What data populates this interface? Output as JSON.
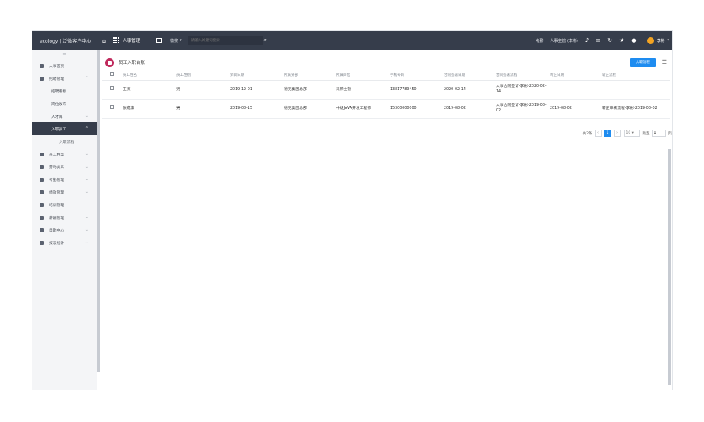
{
  "topbar": {
    "brand": "ecology | 泛微客户中心",
    "module": "人事管理",
    "search_scope": "微搜",
    "search_placeholder": "请输入关键词搜索",
    "right_items": [
      "考勤",
      "人事主管 (李彬)"
    ],
    "user": "李彬"
  },
  "sidebar": {
    "collapse": "≡",
    "items": [
      {
        "label": "人事首页"
      },
      {
        "label": "招聘管理"
      },
      {
        "label": "招聘看板"
      },
      {
        "label": "岗位发布"
      },
      {
        "label": "人才库"
      },
      {
        "label": "入职员工"
      },
      {
        "label": "入职流程"
      },
      {
        "label": "员工档案"
      },
      {
        "label": "劳动关系"
      },
      {
        "label": "考勤管理"
      },
      {
        "label": "绩效管理"
      },
      {
        "label": "培训管理"
      },
      {
        "label": "薪酬管理"
      },
      {
        "label": "自助中心"
      },
      {
        "label": "报表统计"
      }
    ]
  },
  "main": {
    "title": "员工入职台账",
    "primary_button": "入职流程",
    "columns": [
      "员工姓名",
      "员工性别",
      "到岗日期",
      "所属分部",
      "所属岗位",
      "手机号码",
      "合同签署日期",
      "合同签署流程",
      "转正日期",
      "转正流程"
    ],
    "rows": [
      [
        "王侦",
        "男",
        "2019-12-01",
        "德克集团总部",
        "采购主管",
        "13817789450",
        "2020-02-14",
        "人事合同签订-李彬-2020-02-14",
        "",
        ""
      ],
      [
        "张成康",
        "男",
        "2019-08-15",
        "德克集团总部",
        "中级JAVA开发工程师",
        "15300000000",
        "2019-08-02",
        "人事合同签订-李彬-2019-08-02",
        "2019-08-02",
        "转正审核流程-李彬-2019-08-02"
      ]
    ],
    "pagination": {
      "total": "共2条",
      "current_page": "1",
      "page_size": "10 ▾",
      "goto_label": "跳至",
      "goto_value": "1",
      "unit": "页"
    }
  },
  "colors": {
    "topbar": "#363d4b",
    "accent": "#1e8cf0",
    "page_icon": "#c0295c",
    "avatar": "#f4a422"
  }
}
